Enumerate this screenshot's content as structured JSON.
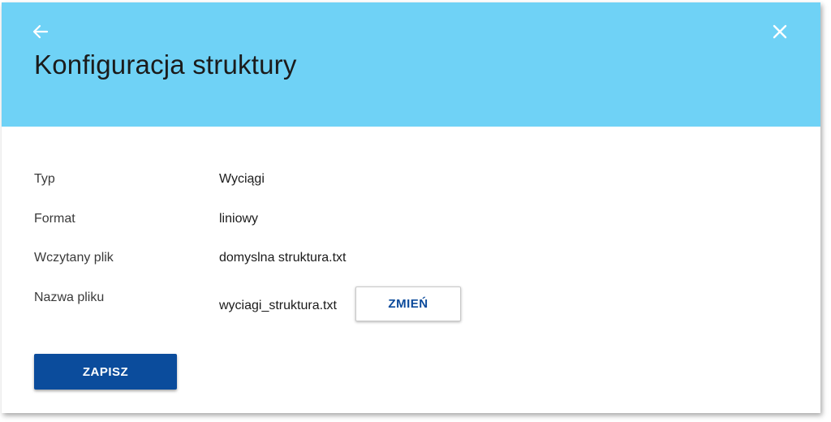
{
  "header": {
    "title": "Konfiguracja struktury",
    "background_color": "#6fd2f6",
    "back_icon": "arrow-left-icon",
    "close_icon": "close-icon"
  },
  "details": [
    {
      "label": "Typ",
      "value": "Wyciągi"
    },
    {
      "label": "Format",
      "value": "liniowy"
    },
    {
      "label": "Wczytany plik",
      "value": "domyslna struktura.txt"
    },
    {
      "label": "Nazwa pliku",
      "value": "wyciagi_struktura.txt"
    }
  ],
  "buttons": {
    "change_label": "ZMIEŃ",
    "save_label": "ZAPISZ",
    "primary_color": "#0b4c9c"
  }
}
